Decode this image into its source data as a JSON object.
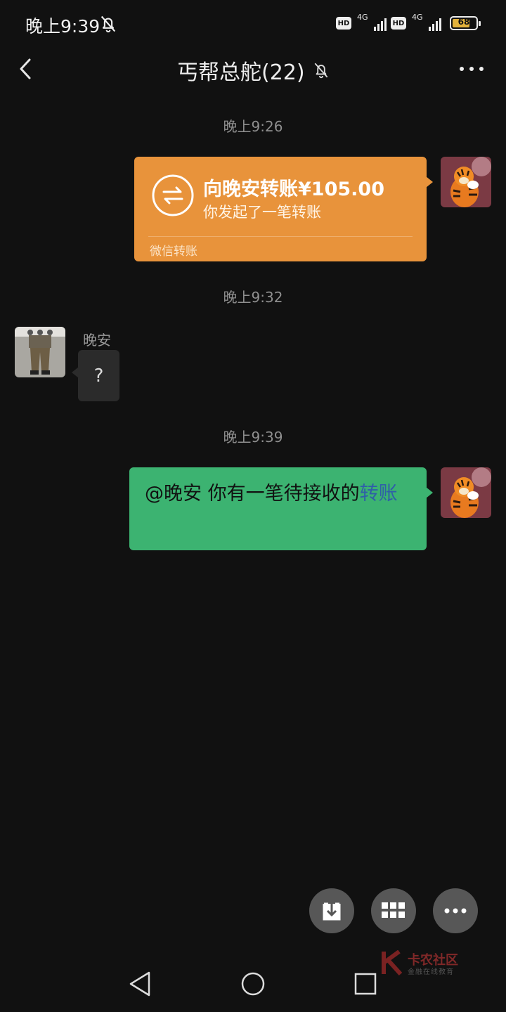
{
  "status_bar": {
    "time": "晚上9:39",
    "hd_label": "HD",
    "network_label": "4G",
    "battery_level": "68"
  },
  "header": {
    "title": "丐帮总舵(22)"
  },
  "messages": {
    "ts1": "晚上9:26",
    "transfer": {
      "title": "向晚安转账¥105.00",
      "subtitle": "你发起了一笔转账",
      "footer": "微信转账"
    },
    "ts2": "晚上9:32",
    "incoming": {
      "sender": "晚安",
      "text": "?"
    },
    "ts3": "晚上9:39",
    "outgoing": {
      "text": "@晚安 你有一笔待接收的",
      "link": "转账"
    }
  },
  "watermark": {
    "title": "卡农社区",
    "subtitle": "金融在线教育"
  },
  "colors": {
    "background": "#111111",
    "transfer_card": "#e8933b",
    "outgoing_bubble": "#3cb371",
    "incoming_bubble": "#2b2b2b",
    "link": "#2f5fa8"
  }
}
